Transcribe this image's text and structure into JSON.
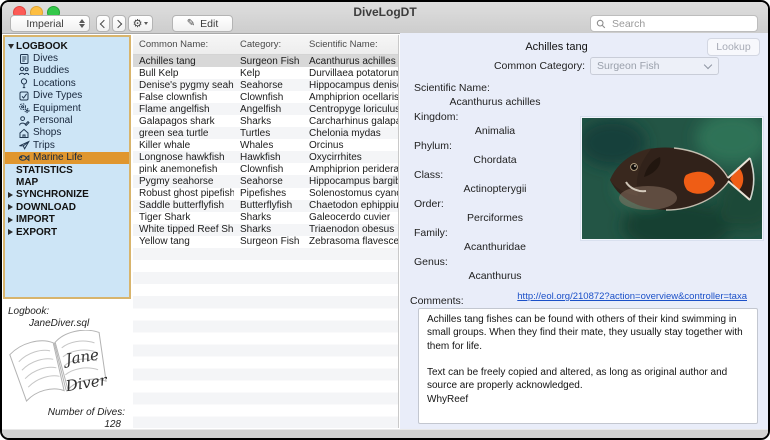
{
  "window": {
    "title": "DiveLogDT"
  },
  "toolbar": {
    "units_value": "Imperial",
    "edit_label": "Edit",
    "search_placeholder": "Search"
  },
  "sidebar": {
    "items": [
      {
        "label": "LOGBOOK",
        "kind": "header",
        "arrow": "down",
        "icon": null
      },
      {
        "label": "Dives",
        "kind": "item",
        "icon": "logbook-icon"
      },
      {
        "label": "Buddies",
        "kind": "item",
        "icon": "buddies-icon"
      },
      {
        "label": "Locations",
        "kind": "item",
        "icon": "location-pin-icon"
      },
      {
        "label": "Dive Types",
        "kind": "item",
        "icon": "checkbox-icon"
      },
      {
        "label": "Equipment",
        "kind": "item",
        "icon": "gears-icon"
      },
      {
        "label": "Personal",
        "kind": "item",
        "icon": "person-pencil-icon"
      },
      {
        "label": "Shops",
        "kind": "item",
        "icon": "house-icon"
      },
      {
        "label": "Trips",
        "kind": "item",
        "icon": "airplane-icon"
      },
      {
        "label": "Marine Life",
        "kind": "item",
        "icon": "fish-icon",
        "selected": true
      },
      {
        "label": "STATISTICS",
        "kind": "header",
        "arrow": null
      },
      {
        "label": "MAP",
        "kind": "header",
        "arrow": null
      },
      {
        "label": "SYNCHRONIZE",
        "kind": "header",
        "arrow": "right"
      },
      {
        "label": "DOWNLOAD",
        "kind": "header",
        "arrow": "right"
      },
      {
        "label": "IMPORT",
        "kind": "header",
        "arrow": "right"
      },
      {
        "label": "EXPORT",
        "kind": "header",
        "arrow": "right"
      }
    ]
  },
  "logbook_info": {
    "label": "Logbook:",
    "filename": "JaneDiver.sql",
    "book_line1": "Jane",
    "book_line2": "Diver",
    "dives_label": "Number of Dives:",
    "dives_count": "128"
  },
  "species_table": {
    "headers": [
      "Common Name:",
      "Category:",
      "Scientific Name:"
    ],
    "selected_row": 0,
    "rows": [
      [
        "Achilles tang",
        "Surgeon Fish",
        "Acanthurus achilles"
      ],
      [
        "Bull Kelp",
        "Kelp",
        "Durvillaea potatorum"
      ],
      [
        "Denise's pygmy seahor...",
        "Seahorse",
        "Hippocampus denise"
      ],
      [
        "False clownfish",
        "Clownfish",
        "Amphiprion ocellaris"
      ],
      [
        "Flame angelfish",
        "Angelfish",
        "Centropyge loriculus"
      ],
      [
        "Galapagos shark",
        "Sharks",
        "Carcharhinus galapa..."
      ],
      [
        "green sea turtle",
        "Turtles",
        "Chelonia mydas"
      ],
      [
        "Killer whale",
        "Whales",
        "Orcinus"
      ],
      [
        "Longnose hawkfish",
        "Hawkfish",
        "Oxycirrhites"
      ],
      [
        "pink anemonefish",
        "Clownfish",
        "Amphiprion periderai..."
      ],
      [
        "Pygmy seahorse",
        "Seahorse",
        "Hippocampus bargib..."
      ],
      [
        "Robust ghost pipefish",
        "Pipefishes",
        "Solenostomus cyano..."
      ],
      [
        "Saddle butterflyfish",
        "Butterflyfish",
        "Chaetodon ephippium"
      ],
      [
        "Tiger Shark",
        "Sharks",
        "Galeocerdo cuvier"
      ],
      [
        "White tipped Reef Shark",
        "Sharks",
        "Triaenodon obesus"
      ],
      [
        "Yellow tang",
        "Surgeon Fish",
        "Zebrasoma flavescens"
      ]
    ]
  },
  "detail": {
    "title": "Achilles tang",
    "lookup_label": "Lookup",
    "category_label": "Common Category:",
    "category_value": "Surgeon Fish",
    "fields": [
      {
        "label": "Scientific Name:",
        "value": "Acanthurus achilles"
      },
      {
        "label": "Kingdom:",
        "value": "Animalia"
      },
      {
        "label": "Phylum:",
        "value": "Chordata"
      },
      {
        "label": "Class:",
        "value": "Actinopterygii"
      },
      {
        "label": "Order:",
        "value": "Perciformes"
      },
      {
        "label": "Family:",
        "value": "Acanthuridae"
      },
      {
        "label": "Genus:",
        "value": "Acanthurus"
      }
    ],
    "link": "http://eol.org/210872?action=overview&controller=taxa",
    "comments_label": "Comments:",
    "comments": "Achilles tang fishes can be found with others of their kind swimming in small groups. When they find their mate, they usually stay together with them for life.\n\nText can be freely copied and altered, as long as original author and source are properly acknowledged.\nWhyReef"
  },
  "colors": {
    "sidebar_bg": "#cde5f6",
    "sidebar_border": "#d8b46c",
    "sidebar_selected": "#e0962e",
    "panel_bg": "#e9edf9",
    "selected_row": "#d8d8d8",
    "link_blue": "#1b50c8",
    "traffic_red": "#fc5b57",
    "traffic_yellow": "#fdbe41",
    "traffic_green": "#34c84a"
  }
}
